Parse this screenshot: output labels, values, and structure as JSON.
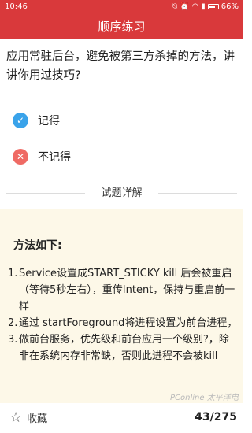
{
  "status_bar": {
    "time": "10:46",
    "icons": [
      "bell-off",
      "alarm",
      "wifi",
      "signal"
    ],
    "battery": "66%"
  },
  "header": {
    "title": "顺序练习"
  },
  "question": {
    "text": "应用常驻后台，避免被第三方杀掉的方法，讲讲你用过技巧?"
  },
  "options": [
    {
      "label": "记得",
      "icon": "check-circle-icon",
      "color": "#3aa3ea",
      "glyph": "✓"
    },
    {
      "label": "不记得",
      "icon": "cross-circle-icon",
      "color": "#ef6a64",
      "glyph": "✕"
    }
  ],
  "detail": {
    "label": "试题详解"
  },
  "explanation": {
    "title": "方法如下:",
    "items": [
      {
        "num": "1.",
        "text": "Service设置成START_STICKY kill 后会被重启（等待5秒左右），重传Intent，保持与重启前一样"
      },
      {
        "num": "2.",
        "text": "通过 startForeground将进程设置为前台进程，"
      },
      {
        "num": "3.",
        "text": "做前台服务，优先级和前台应用一个级别?，除非在系统内存非常缺，否则此进程不会被kill"
      }
    ]
  },
  "bottom": {
    "favorite_label": "收藏",
    "progress": "43/275"
  },
  "watermark": "PConline 太平洋电脑网"
}
